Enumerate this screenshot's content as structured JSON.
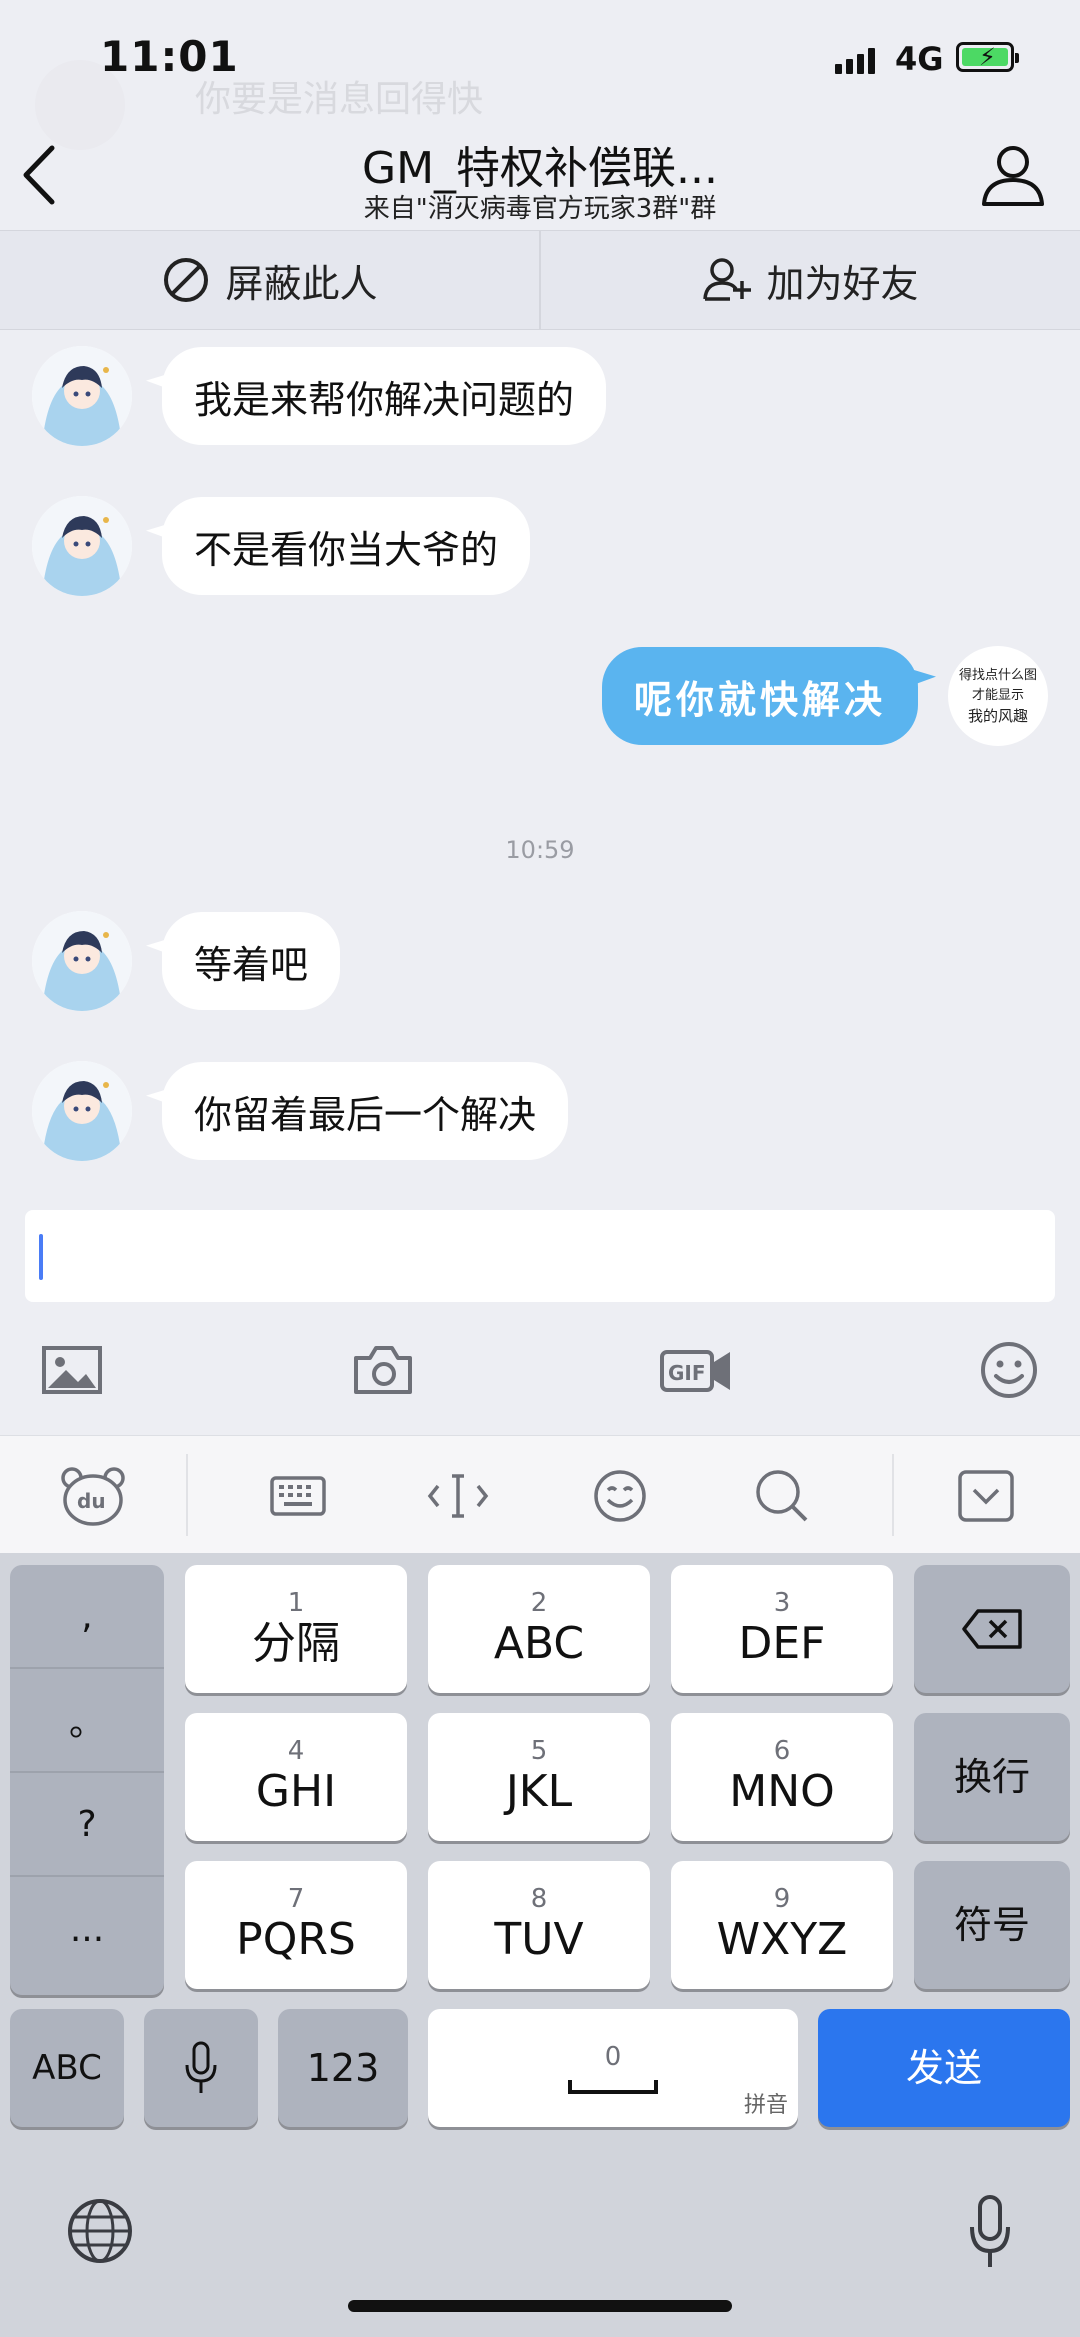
{
  "status_bar": {
    "time": "11:01",
    "network": "4G"
  },
  "ghost_notification": "你要是消息回得快",
  "nav": {
    "title": "GM_特权补偿联...",
    "subtitle": "来自\"消灭病毒官方玩家3群\"群"
  },
  "actions": {
    "block": "屏蔽此人",
    "add_friend": "加为好友"
  },
  "messages": [
    {
      "side": "left",
      "text": "我是来帮你解决问题的"
    },
    {
      "side": "left",
      "text": "不是看你当大爷的"
    },
    {
      "side": "right",
      "text": "呢你就快解决"
    },
    {
      "side": "left",
      "text": "等着吧"
    },
    {
      "side": "left",
      "text": "你留着最后一个解决"
    }
  ],
  "self_avatar": {
    "line1": "得找点什么图",
    "line2": "才能显示",
    "line3": "我的风趣"
  },
  "timestamp": "10:59",
  "input": {
    "value": ""
  },
  "keyboard": {
    "punct": [
      ",",
      "。",
      "?",
      "..."
    ],
    "keys": [
      {
        "num": "1",
        "label": "分隔"
      },
      {
        "num": "2",
        "label": "ABC"
      },
      {
        "num": "3",
        "label": "DEF"
      },
      {
        "num": "4",
        "label": "GHI"
      },
      {
        "num": "5",
        "label": "JKL"
      },
      {
        "num": "6",
        "label": "MNO"
      },
      {
        "num": "7",
        "label": "PQRS"
      },
      {
        "num": "8",
        "label": "TUV"
      },
      {
        "num": "9",
        "label": "WXYZ"
      }
    ],
    "newline": "换行",
    "symbols": "符号",
    "abc": "ABC",
    "num_mode": "123",
    "space_num": "0",
    "pinyin": "拼音",
    "send": "发送"
  },
  "colors": {
    "accent": "#2B76EE",
    "bubble_self": "#5AB4EF",
    "background": "#EDEEF3"
  }
}
